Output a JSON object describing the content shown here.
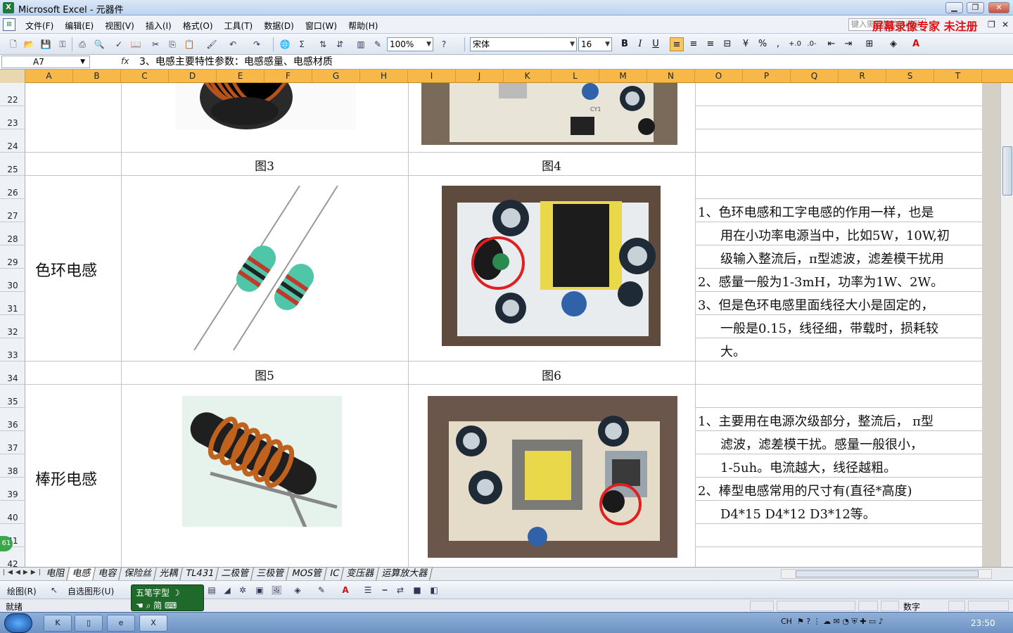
{
  "window": {
    "title": "Microsoft Excel - 元器件",
    "app_icon": "excel-icon"
  },
  "menu": {
    "items": [
      "文件(F)",
      "编辑(E)",
      "视图(V)",
      "插入(I)",
      "格式(O)",
      "工具(T)",
      "数据(D)",
      "窗口(W)",
      "帮助(H)"
    ],
    "help_placeholder": "键入需要帮助的问题",
    "watermark": "屏幕录像专家 未注册"
  },
  "toolbar": {
    "zoom": "100%",
    "font_name": "宋体",
    "font_size": "16",
    "bold": "B",
    "italic": "I",
    "underline": "U",
    "percent": "%",
    "comma": ","
  },
  "formula_bar": {
    "name_box": "A7",
    "fx": "fx",
    "content": "3、电感主要特性参数：电感感量、电感材质"
  },
  "columns": [
    "A",
    "B",
    "C",
    "D",
    "E",
    "F",
    "G",
    "H",
    "I",
    "J",
    "K",
    "L",
    "M",
    "N",
    "O",
    "P",
    "Q",
    "R",
    "S",
    "T"
  ],
  "rows": [
    "22",
    "23",
    "24",
    "25",
    "26",
    "27",
    "28",
    "29",
    "30",
    "31",
    "32",
    "33",
    "34",
    "35",
    "36",
    "37",
    "38",
    "39",
    "40",
    "41",
    "42"
  ],
  "sheet": {
    "captions": {
      "fig3": "图3",
      "fig4": "图4",
      "fig5": "图5",
      "fig6": "图6"
    },
    "section_color_ring": {
      "label": "色环电感",
      "notes": [
        "1、色环电感和工字电感的作用一样，也是",
        "用在小功率电源当中，比如5W，10W,初",
        "级输入整流后，π型滤波，滤差模干扰用",
        "2、感量一般为1-3mH，功率为1W、2W。",
        "3、但是色环电感里面线径大小是固定的，",
        "一般是0.15，线径细，带载时，损耗较",
        "大。"
      ]
    },
    "section_rod": {
      "label": "棒形电感",
      "notes": [
        "1、主要用在电源次级部分，整流后， π型",
        "滤波，滤差模干扰。感量一般很小，",
        "1-5uh。电流越大，线径越粗。",
        "2、棒型电感常用的尺寸有(直径*高度)",
        "D4*15 D4*12 D3*12等。"
      ]
    }
  },
  "sheet_tabs": {
    "tabs": [
      "电阻",
      "电感",
      "电容",
      "保险丝",
      "光耦",
      "TL431",
      "二极管",
      "三极管",
      "MOS管",
      "IC",
      "变压器",
      "运算放大器"
    ],
    "active": "电感"
  },
  "draw_toolbar": {
    "draw_label": "绘图(R)",
    "autoshape_label": "自选图形(U)"
  },
  "ime": {
    "line1": "五笔字型",
    "line2": "简"
  },
  "status": {
    "ready": "就绪",
    "num": "数字"
  },
  "side_badge": "61",
  "taskbar": {
    "tray_lang": "CH",
    "clock": "23:50"
  },
  "colors": {
    "column_header": "#f7b84a",
    "watermark": "#e01010",
    "circle_marker": "#e02020"
  }
}
